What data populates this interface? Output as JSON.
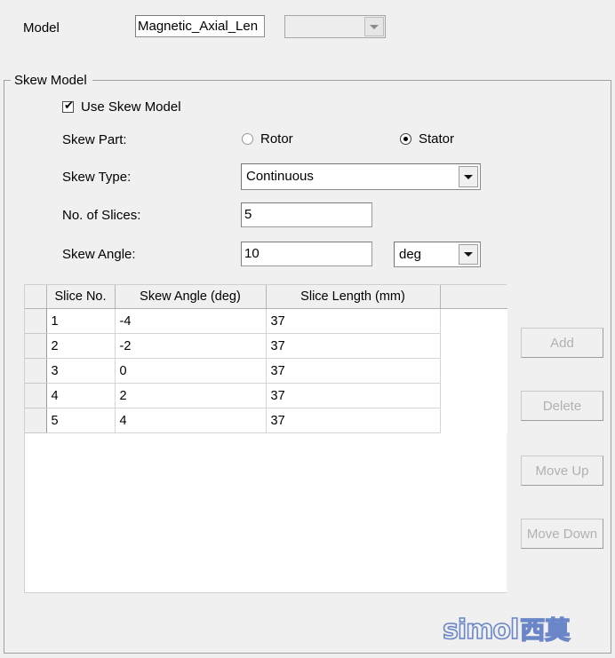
{
  "model_row": {
    "label": "Model",
    "text_value": "Magnetic_Axial_Len",
    "combo_value": ""
  },
  "skew_group": {
    "title": "Skew Model",
    "use_skew_model": {
      "label": "Use Skew Model",
      "checked_glyph": "✔"
    },
    "skew_part": {
      "label": "Skew Part:",
      "options": [
        "Rotor",
        "Stator"
      ],
      "selected": "Stator"
    },
    "skew_type": {
      "label": "Skew Type:",
      "value": "Continuous"
    },
    "no_of_slices": {
      "label": "No. of Slices:",
      "value": "5"
    },
    "skew_angle": {
      "label": "Skew Angle:",
      "value": "10",
      "unit": "deg"
    }
  },
  "table": {
    "columns": [
      "",
      "Slice No.",
      "Skew Angle (deg)",
      "Slice Length (mm)",
      ""
    ],
    "rows": [
      {
        "slice_no": "1",
        "skew_angle": "-4",
        "slice_length": "37"
      },
      {
        "slice_no": "2",
        "skew_angle": "-2",
        "slice_length": "37"
      },
      {
        "slice_no": "3",
        "skew_angle": "0",
        "slice_length": "37"
      },
      {
        "slice_no": "4",
        "skew_angle": "2",
        "slice_length": "37"
      },
      {
        "slice_no": "5",
        "skew_angle": "4",
        "slice_length": "37"
      }
    ]
  },
  "buttons": {
    "add": "Add",
    "delete": "Delete",
    "move_up": "Move Up",
    "move_down": "Move Down"
  },
  "brand": {
    "latin": "simol",
    "cjk": "西莫",
    "color": "#6a86c8"
  }
}
